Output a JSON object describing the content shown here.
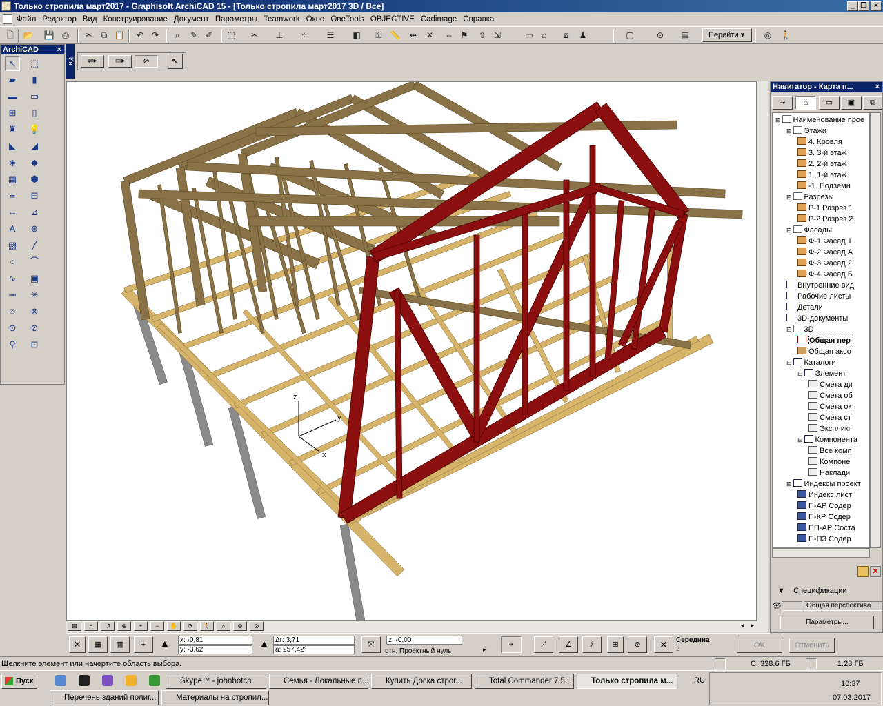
{
  "window": {
    "title": "Только стропила март2017 - Graphisoft ArchiCAD 15 - [Только стропила март2017 3D / Все]"
  },
  "menu": [
    "Файл",
    "Редактор",
    "Вид",
    "Конструирование",
    "Документ",
    "Параметры",
    "Teamwork",
    "Окно",
    "OneTools",
    "OBJECTIVE",
    "Cadimage",
    "Справка"
  ],
  "toolbar": {
    "goto_label": "Перейти"
  },
  "palette": {
    "title": "ArchiCAD",
    "side_tab": "Ин"
  },
  "navigator": {
    "title": "Навигатор - Карта п...",
    "tree": [
      {
        "label": "Наименование прое",
        "level": 0,
        "kind": "root"
      },
      {
        "label": "Этажи",
        "level": 1,
        "kind": "folder"
      },
      {
        "label": "4. Кровля",
        "level": 2,
        "kind": "story"
      },
      {
        "label": "3. 3-й этаж",
        "level": 2,
        "kind": "story"
      },
      {
        "label": "2. 2-й этаж",
        "level": 2,
        "kind": "story"
      },
      {
        "label": "1. 1-й этаж",
        "level": 2,
        "kind": "story"
      },
      {
        "label": "-1. Подземн",
        "level": 2,
        "kind": "story"
      },
      {
        "label": "Разрезы",
        "level": 1,
        "kind": "folder"
      },
      {
        "label": "Р-1 Разрез 1",
        "level": 2,
        "kind": "section"
      },
      {
        "label": "Р-2 Разрез 2",
        "level": 2,
        "kind": "section"
      },
      {
        "label": "Фасады",
        "level": 1,
        "kind": "folder"
      },
      {
        "label": "Ф-1 Фасад 1",
        "level": 2,
        "kind": "section"
      },
      {
        "label": "Ф-2 Фасад А",
        "level": 2,
        "kind": "section"
      },
      {
        "label": "Ф-3 Фасад 2",
        "level": 2,
        "kind": "section"
      },
      {
        "label": "Ф-4 Фасад Б",
        "level": 2,
        "kind": "section"
      },
      {
        "label": "Внутренние вид",
        "level": 1,
        "kind": "doc"
      },
      {
        "label": "Рабочие листы",
        "level": 1,
        "kind": "doc"
      },
      {
        "label": "Детали",
        "level": 1,
        "kind": "doc"
      },
      {
        "label": "3D-документы",
        "level": 1,
        "kind": "doc"
      },
      {
        "label": "3D",
        "level": 1,
        "kind": "folder"
      },
      {
        "label": "Общая пер",
        "level": 2,
        "kind": "eye",
        "selected": true
      },
      {
        "label": "Общая аксо",
        "level": 2,
        "kind": "cube"
      },
      {
        "label": "Каталоги",
        "level": 1,
        "kind": "table"
      },
      {
        "label": "Элемент",
        "level": 2,
        "kind": "table"
      },
      {
        "label": "Смета ди",
        "level": 3,
        "kind": "list"
      },
      {
        "label": "Смета об",
        "level": 3,
        "kind": "list"
      },
      {
        "label": "Смета ок",
        "level": 3,
        "kind": "list"
      },
      {
        "label": "Смета ст",
        "level": 3,
        "kind": "list"
      },
      {
        "label": "Экспликг",
        "level": 3,
        "kind": "list"
      },
      {
        "label": "Компонента",
        "level": 2,
        "kind": "table"
      },
      {
        "label": "Все комп",
        "level": 3,
        "kind": "list"
      },
      {
        "label": "Компоне",
        "level": 3,
        "kind": "list"
      },
      {
        "label": "Наклади",
        "level": 3,
        "kind": "list"
      },
      {
        "label": "Индексы проект",
        "level": 1,
        "kind": "doc"
      },
      {
        "label": "Индекс лист",
        "level": 2,
        "kind": "sheet"
      },
      {
        "label": "П-АР Содер",
        "level": 2,
        "kind": "sheet"
      },
      {
        "label": "П-КР Содер",
        "level": 2,
        "kind": "sheet"
      },
      {
        "label": "ПП-АР Соста",
        "level": 2,
        "kind": "sheet"
      },
      {
        "label": "П-ПЗ Содер",
        "level": 2,
        "kind": "sheet"
      }
    ],
    "spec_label": "Спецификации",
    "view_name": "Общая перспектива",
    "params_button": "Параметры..."
  },
  "infobar": {
    "x": "x: -0,81",
    "y": "y: -3,62",
    "dr": "Δr: 3,71",
    "a": "a: 257,42°",
    "z": "z: -0,00",
    "ref": "отн. Проектный нуль",
    "snap": "Середина",
    "snap_n": "2",
    "ok": "OK",
    "cancel": "Отменить"
  },
  "axes": {
    "x": "x",
    "y": "y",
    "z": "z"
  },
  "status": {
    "hint": "Щелкните элемент или начертите область выбора.",
    "disk": "C: 328.6 ГБ",
    "mem": "1.23 ГБ"
  },
  "taskbar": {
    "start": "Пуск",
    "row1": [
      "Skype™ - johnbotch",
      "Семья - Локальные п...",
      "Купить Доска строг...",
      "Total Commander 7.5...",
      "Только стропила м..."
    ],
    "row2": [
      "Перечень зданий полиг...",
      "Материалы на стропил..."
    ],
    "lang": "RU",
    "time": "10:37",
    "date": "07.03.2017"
  },
  "colors": {
    "wood": "#8a7248",
    "wood_light": "#d6b56a",
    "truss": "#8b0f0f",
    "title_blue": "#0a246a"
  }
}
